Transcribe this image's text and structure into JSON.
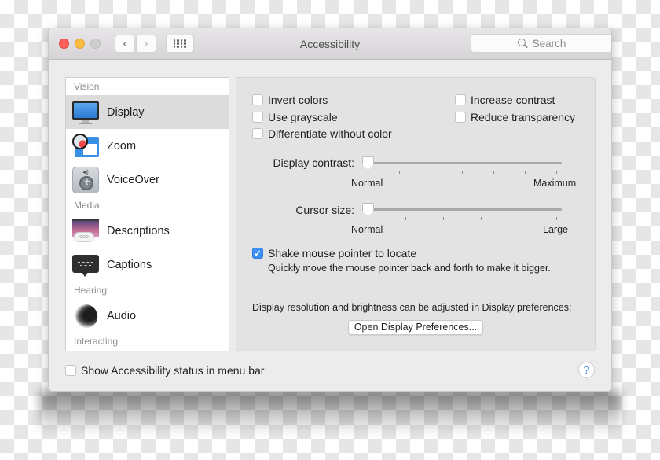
{
  "window": {
    "title": "Accessibility",
    "search_placeholder": "Search",
    "nav": {
      "back": "‹",
      "forward": "›"
    }
  },
  "sidebar": {
    "sections": [
      {
        "label": "Vision",
        "items": [
          {
            "label": "Display",
            "icon": "display-icon",
            "selected": true
          },
          {
            "label": "Zoom",
            "icon": "zoom-icon",
            "selected": false
          },
          {
            "label": "VoiceOver",
            "icon": "voiceover-icon",
            "selected": false
          }
        ]
      },
      {
        "label": "Media",
        "items": [
          {
            "label": "Descriptions",
            "icon": "descriptions-icon",
            "selected": false
          },
          {
            "label": "Captions",
            "icon": "captions-icon",
            "selected": false
          }
        ]
      },
      {
        "label": "Hearing",
        "items": [
          {
            "label": "Audio",
            "icon": "audio-icon",
            "selected": false
          }
        ]
      },
      {
        "label": "Interacting",
        "items": []
      }
    ]
  },
  "display_panel": {
    "checkboxes": {
      "invert_colors": {
        "label": "Invert colors",
        "checked": false
      },
      "use_grayscale": {
        "label": "Use grayscale",
        "checked": false
      },
      "differentiate_without_color": {
        "label": "Differentiate without color",
        "checked": false
      },
      "increase_contrast": {
        "label": "Increase contrast",
        "checked": false
      },
      "reduce_transparency": {
        "label": "Reduce transparency",
        "checked": false
      }
    },
    "display_contrast": {
      "label": "Display contrast:",
      "min_label": "Normal",
      "max_label": "Maximum",
      "value": 0,
      "ticks": 7
    },
    "cursor_size": {
      "label": "Cursor size:",
      "min_label": "Normal",
      "max_label": "Large",
      "value": 0,
      "ticks": 6
    },
    "shake_pointer": {
      "label": "Shake mouse pointer to locate",
      "checked": true,
      "hint": "Quickly move the mouse pointer back and forth to make it bigger."
    },
    "resolution_note": "Display resolution and brightness can be adjusted in Display preferences:",
    "open_prefs_button": "Open Display Preferences..."
  },
  "footer": {
    "show_status": {
      "label": "Show Accessibility status in menu bar",
      "checked": false
    },
    "help": "?"
  },
  "colors": {
    "accent": "#3d8ef5",
    "selection": "#dcdcdc",
    "close": "#fc605c",
    "minimize": "#fdbc40"
  }
}
